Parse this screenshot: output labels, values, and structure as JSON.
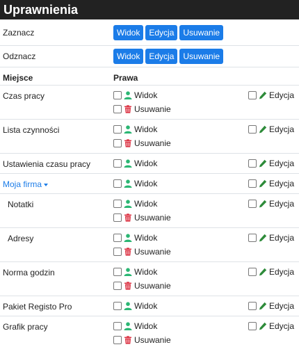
{
  "title": "Uprawnienia",
  "select_rows": [
    {
      "label": "Zaznacz",
      "buttons": [
        "Widok",
        "Edycja",
        "Usuwanie"
      ]
    },
    {
      "label": "Odznacz",
      "buttons": [
        "Widok",
        "Edycja",
        "Usuwanie"
      ]
    }
  ],
  "table": {
    "col_place": "Miejsce",
    "col_rights": "Prawa",
    "rows": [
      {
        "place": "Czas pracy",
        "widok": "Widok",
        "edycja": "Edycja",
        "usuwanie": "Usuwanie"
      },
      {
        "place": "Lista czynności",
        "widok": "Widok",
        "edycja": "Edycja",
        "usuwanie": "Usuwanie"
      },
      {
        "place": "Ustawienia czasu pracy",
        "widok": "Widok",
        "edycja": "Edycja"
      },
      {
        "place": "Moja firma",
        "widok": "Widok",
        "edycja": "Edycja"
      },
      {
        "place": "Notatki",
        "widok": "Widok",
        "edycja": "Edycja",
        "usuwanie": "Usuwanie"
      },
      {
        "place": "Adresy",
        "widok": "Widok",
        "edycja": "Edycja",
        "usuwanie": "Usuwanie"
      },
      {
        "place": "Norma godzin",
        "widok": "Widok",
        "edycja": "Edycja",
        "usuwanie": "Usuwanie"
      },
      {
        "place": "Pakiet Registo Pro",
        "widok": "Widok",
        "edycja": "Edycja"
      },
      {
        "place": "Grafik pracy",
        "widok": "Widok",
        "edycja": "Edycja",
        "usuwanie": "Usuwanie"
      }
    ]
  },
  "icons": {
    "widok": "user-icon",
    "edycja": "pencil-icon",
    "usuwanie": "trash-icon"
  },
  "colors": {
    "header_bg": "#222222",
    "button_bg": "#1b7ce8",
    "link": "#1b7ce8",
    "user_icon": "#2bb673",
    "pencil_icon": "#2e8b3a",
    "trash_icon": "#dc3545"
  }
}
